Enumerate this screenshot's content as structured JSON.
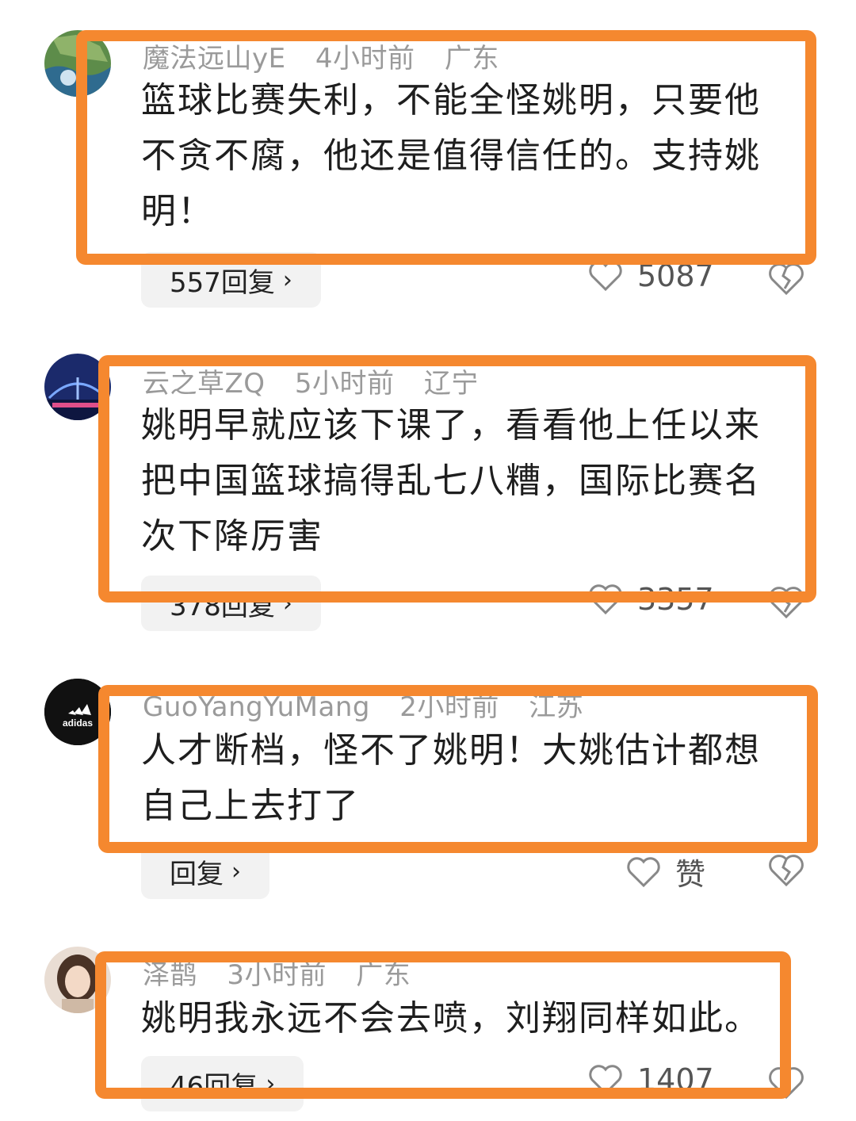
{
  "comments": [
    {
      "username": "魔法远山yE",
      "time": "4小时前",
      "location": "广东",
      "text": "篮球比赛失利，不能全怪姚明，只要他不贪不腐，他还是值得信任的。支持姚明！",
      "reply_label": "557回复",
      "likes": "5087"
    },
    {
      "username": "云之草ZQ",
      "time": "5小时前",
      "location": "辽宁",
      "text": "姚明早就应该下课了，看看他上任以来把中国篮球搞得乱七八糟，国际比赛名次下降厉害",
      "reply_label": "378回复",
      "likes": "3357"
    },
    {
      "username": "GuoYangYuMang",
      "time": "2小时前",
      "location": "江苏",
      "text": "人才断档，怪不了姚明！大姚估计都想自己上去打了",
      "reply_label": "回复",
      "likes": "赞"
    },
    {
      "username": "泽鹊",
      "time": "3小时前",
      "location": "广东",
      "text": "姚明我永远不会去喷，刘翔同样如此。",
      "reply_label": "46回复",
      "likes": "1407"
    }
  ],
  "icons": {
    "like": "heart-outline-icon",
    "dislike": "broken-heart-icon",
    "chevron": "chevron-right-icon"
  },
  "colors": {
    "highlight_border": "#F5882F",
    "reply_pill_bg": "#F2F2F2",
    "meta_text": "#9A9A9A"
  },
  "avatars": {
    "c3_logo_text": "adidas"
  }
}
